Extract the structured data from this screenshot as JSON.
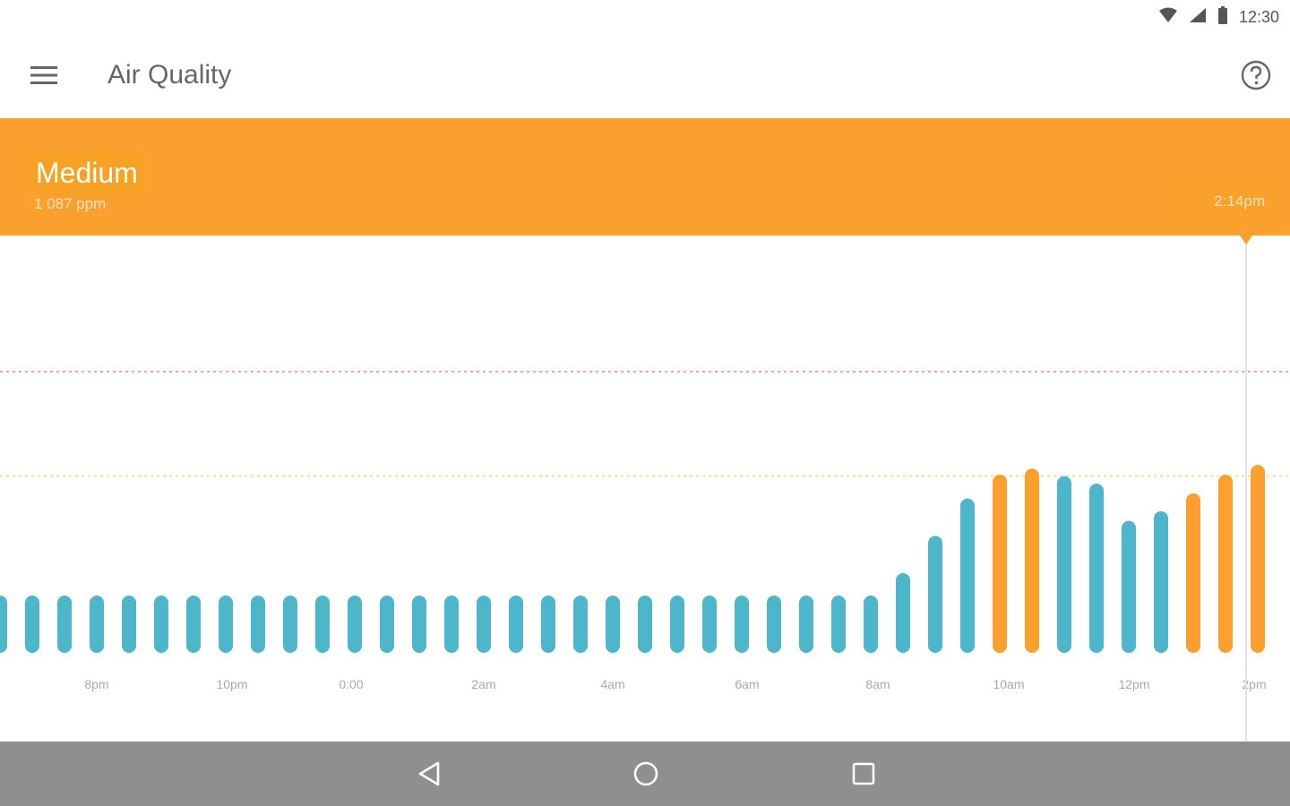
{
  "status_bar": {
    "time": "12:30",
    "icons": [
      "wifi-icon",
      "cell-signal-icon",
      "battery-icon"
    ]
  },
  "app_bar": {
    "title": "Air Quality",
    "menu_icon": "hamburger-menu-icon",
    "help_icon": "help-circle-icon"
  },
  "banner": {
    "level": "Medium",
    "reading": "1 087 ppm",
    "time": "2:14pm",
    "color": "#FBA02E"
  },
  "chart_data": {
    "type": "bar",
    "x_ticks": [
      "8pm",
      "10pm",
      "0:00",
      "2am",
      "4am",
      "6am",
      "8am",
      "10am",
      "12pm",
      "2pm"
    ],
    "values": [
      700,
      700,
      700,
      700,
      700,
      700,
      700,
      700,
      700,
      700,
      700,
      700,
      700,
      700,
      700,
      700,
      700,
      700,
      700,
      700,
      700,
      700,
      700,
      700,
      700,
      700,
      700,
      700,
      730,
      780,
      830,
      862,
      870,
      860,
      850,
      800,
      813,
      837,
      862,
      875
    ],
    "bar_colors": [
      "teal",
      "teal",
      "teal",
      "teal",
      "teal",
      "teal",
      "teal",
      "teal",
      "teal",
      "teal",
      "teal",
      "teal",
      "teal",
      "teal",
      "teal",
      "teal",
      "teal",
      "teal",
      "teal",
      "teal",
      "teal",
      "teal",
      "teal",
      "teal",
      "teal",
      "teal",
      "teal",
      "teal",
      "teal",
      "teal",
      "teal",
      "orange",
      "orange",
      "teal",
      "teal",
      "teal",
      "teal",
      "orange",
      "orange",
      "orange"
    ],
    "colors": {
      "teal": "#4DB6CB",
      "orange": "#FBA02E"
    },
    "thresholds": [
      {
        "value": 1000,
        "color": "#F2A0A0"
      },
      {
        "value": 860,
        "color": "#F5DC9A"
      }
    ],
    "ylim": [
      500,
      1100
    ],
    "grid": false,
    "highlight_time": "2:14pm"
  },
  "nav_bar": {
    "back_icon": "back-triangle-icon",
    "home_icon": "home-circle-icon",
    "recents_icon": "recents-square-icon"
  }
}
